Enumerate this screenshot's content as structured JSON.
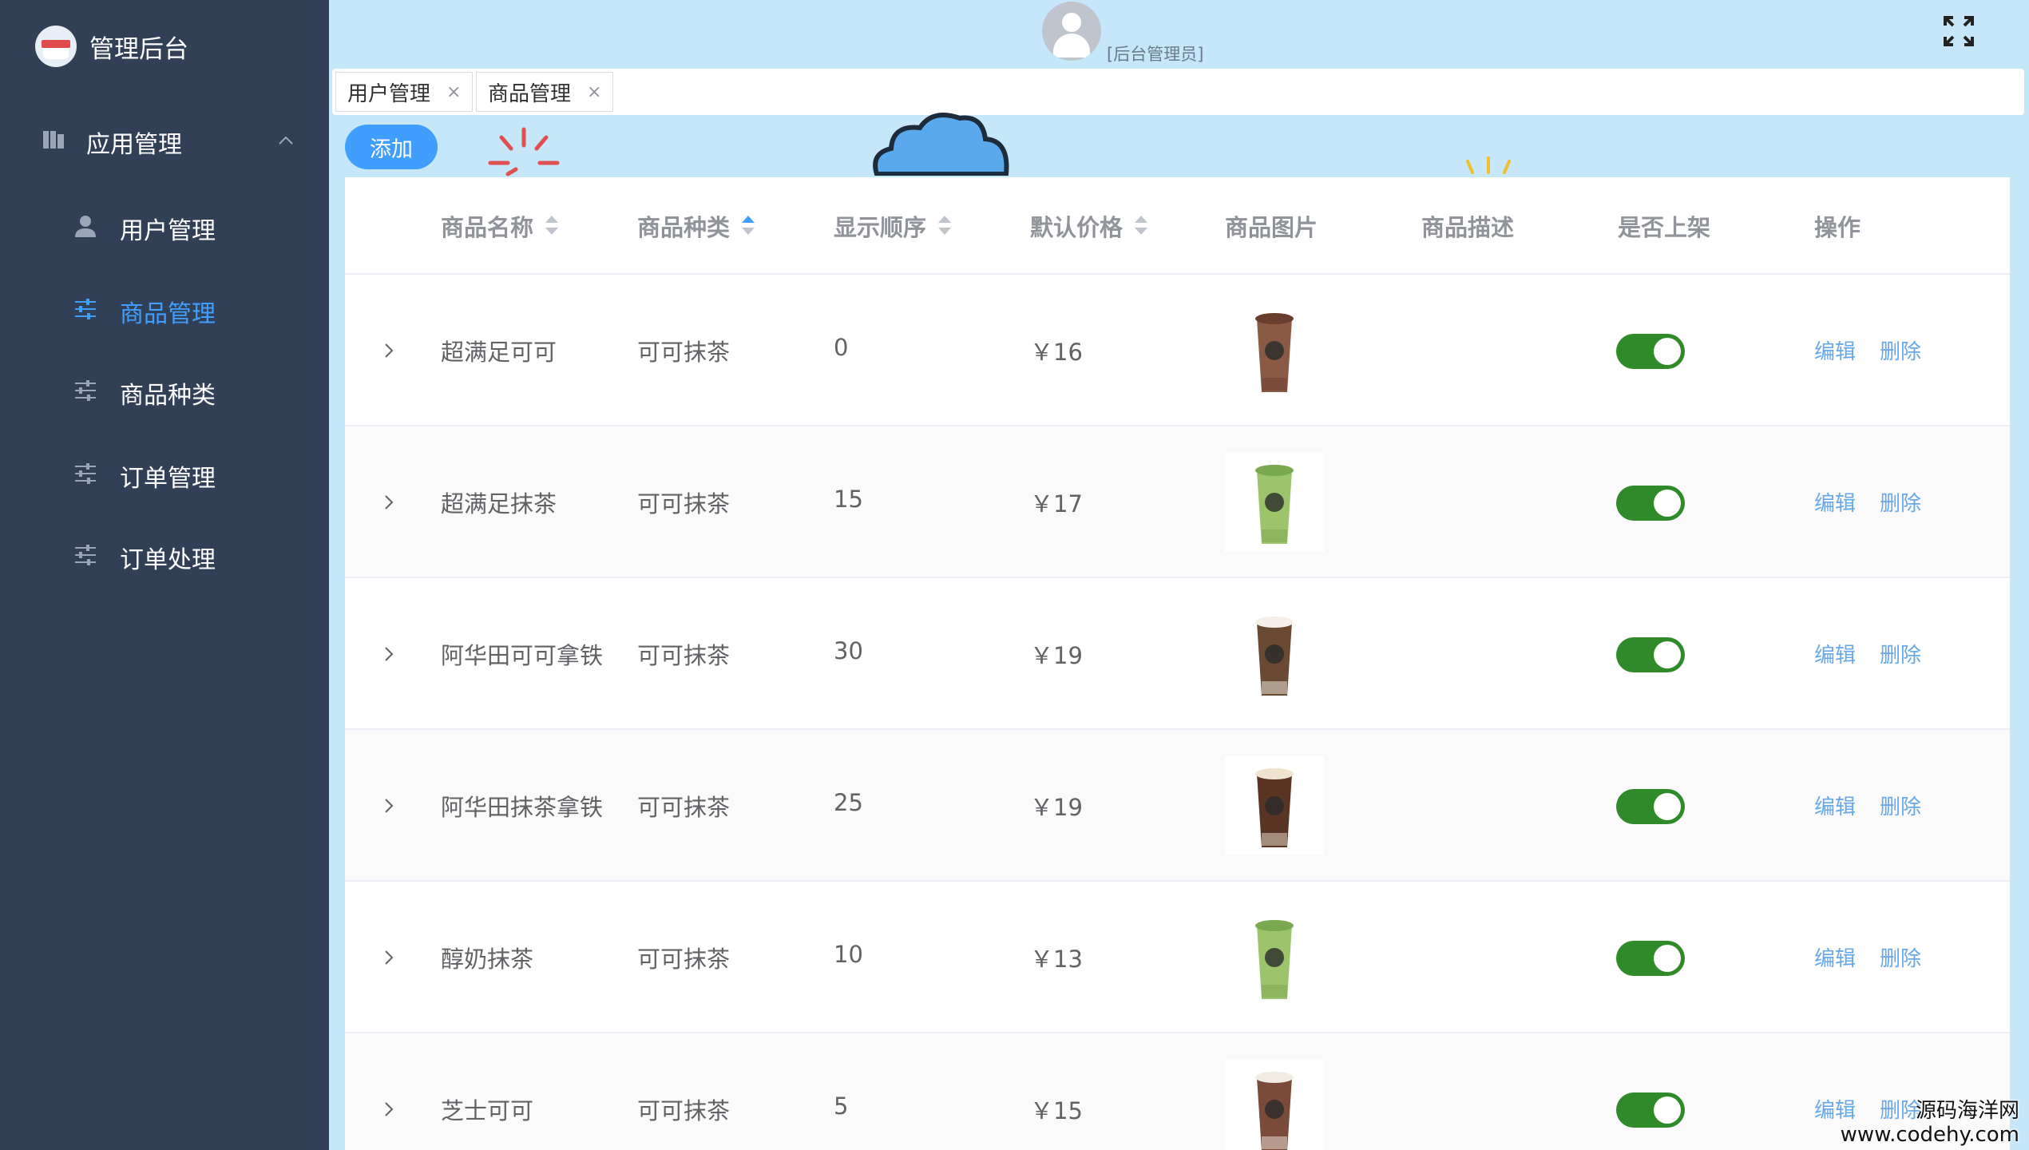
{
  "sidebar": {
    "brand": "管理后台",
    "group": {
      "label": "应用管理"
    },
    "items": [
      {
        "label": "用户管理",
        "icon": "user-icon"
      },
      {
        "label": "商品管理",
        "icon": "sliders-icon",
        "active": true
      },
      {
        "label": "商品种类",
        "icon": "sliders-icon"
      },
      {
        "label": "订单管理",
        "icon": "sliders-icon"
      },
      {
        "label": "订单处理",
        "icon": "sliders-icon"
      }
    ]
  },
  "header": {
    "admin_label": "[后台管理员]"
  },
  "tabs": [
    {
      "label": "用户管理",
      "close": "×"
    },
    {
      "label": "商品管理",
      "close": "×"
    }
  ],
  "toolbar": {
    "add_label": "添加"
  },
  "table": {
    "columns": [
      "商品名称",
      "商品种类",
      "显示顺序",
      "默认价格",
      "商品图片",
      "商品描述",
      "是否上架",
      "操作"
    ],
    "edit_label": "编辑",
    "delete_label": "删除",
    "rows": [
      {
        "name": "超满足可可",
        "category": "可可抹茶",
        "order": "0",
        "price": "￥16",
        "on_sale": true,
        "drink": "cocoa"
      },
      {
        "name": "超满足抹茶",
        "category": "可可抹茶",
        "order": "15",
        "price": "￥17",
        "on_sale": true,
        "drink": "matcha"
      },
      {
        "name": "阿华田可可拿铁",
        "category": "可可抹茶",
        "order": "30",
        "price": "￥19",
        "on_sale": true,
        "drink": "cream-cocoa"
      },
      {
        "name": "阿华田抹茶拿铁",
        "category": "可可抹茶",
        "order": "25",
        "price": "￥19",
        "on_sale": true,
        "drink": "cream-choco"
      },
      {
        "name": "醇奶抹茶",
        "category": "可可抹茶",
        "order": "10",
        "price": "￥13",
        "on_sale": true,
        "drink": "matcha"
      },
      {
        "name": "芝士可可",
        "category": "可可抹茶",
        "order": "5",
        "price": "￥15",
        "on_sale": true,
        "drink": "cheese-cocoa"
      }
    ]
  },
  "watermark": {
    "line1": "源码海洋网",
    "line2": "www.codehy.com"
  },
  "colors": {
    "sidebar": "#324057",
    "accent": "#409eff",
    "switch_on": "#2f8a2a",
    "link": "#66a8ea"
  }
}
